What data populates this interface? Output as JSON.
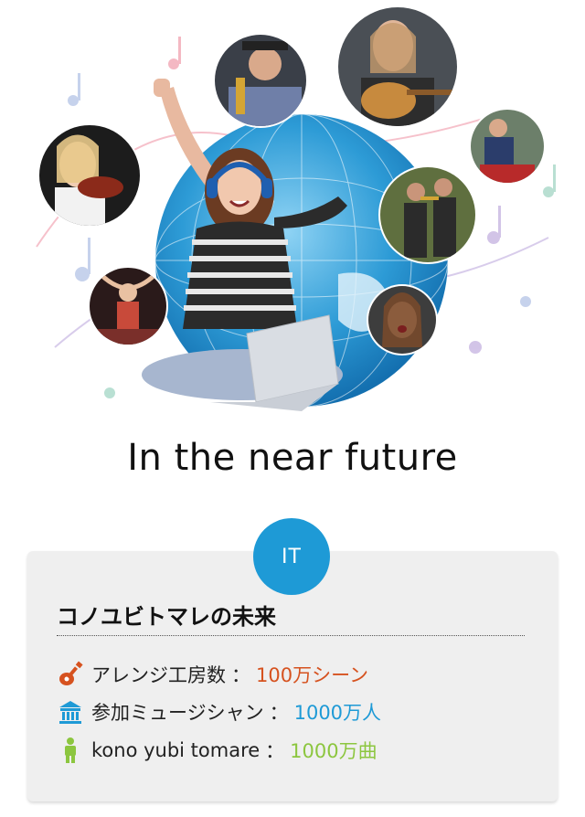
{
  "hero": {
    "image_description_icons": [
      "globe-icon",
      "headphones-icon",
      "laptop-icon",
      "music-notes-icon"
    ]
  },
  "headline": "In the near future",
  "badge": "IT",
  "card": {
    "title": "コノユビトマレの未来",
    "rows": [
      {
        "icon": "guitar-icon",
        "label": "アレンジ工房数",
        "sep": "：",
        "value": "100万シーン",
        "value_color": "#d6521f"
      },
      {
        "icon": "building-icon",
        "label": "参加ミュージシャン",
        "sep": "：",
        "value": "1000万人",
        "value_color": "#1e9ad6"
      },
      {
        "icon": "person-icon",
        "label": "kono yubi tomare",
        "sep": "：",
        "value": "1000万曲",
        "value_color": "#8cc63f"
      }
    ]
  },
  "colors": {
    "accent_blue": "#1e9ad6",
    "accent_orange": "#d6521f",
    "accent_green": "#8cc63f"
  }
}
